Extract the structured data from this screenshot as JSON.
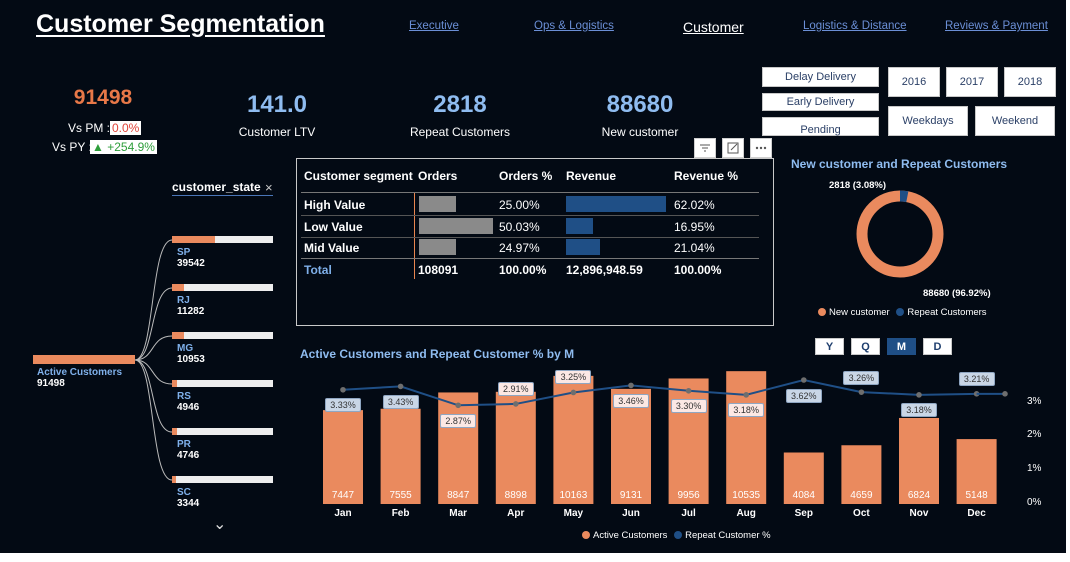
{
  "title": "Customer Segmentation",
  "nav": [
    "Executive",
    "Ops & Logistics",
    "Customer",
    "Logistics & Distance",
    "Reviews & Payment"
  ],
  "active_nav": "Customer",
  "kpis": {
    "active": {
      "value": "91498",
      "vs_pm_label": "Vs PM :",
      "vs_pm_value": "0.0%",
      "vs_py_label": "Vs PY :",
      "vs_py_value": "▲ +254.9%"
    },
    "ltv": {
      "value": "141.0",
      "label": "Customer LTV"
    },
    "repeat": {
      "value": "2818",
      "label": "Repeat Customers"
    },
    "new": {
      "value": "88680",
      "label": "New customer"
    }
  },
  "filters": {
    "delivery": [
      "Delay Delivery",
      "Early Delivery",
      "Pending"
    ],
    "years": [
      "2016",
      "2017",
      "2018"
    ],
    "days": [
      "Weekdays",
      "Weekend"
    ]
  },
  "visual_icons": [
    "filter-icon",
    "focus-mode-icon",
    "more-options-icon"
  ],
  "segment_table": {
    "headers": [
      "Customer segment",
      "Orders",
      "Orders %",
      "Revenue",
      "Revenue %"
    ],
    "rows": [
      {
        "segment": "High Value",
        "orders": 27023,
        "orders_pct": "25.00%",
        "revenue": 8002,
        "revenue_pct": "62.02%"
      },
      {
        "segment": "Low Value",
        "orders": 54075,
        "orders_pct": "50.03%",
        "revenue": 2186,
        "revenue_pct": "16.95%"
      },
      {
        "segment": "Mid Value",
        "orders": 26993,
        "orders_pct": "24.97%",
        "revenue": 2714,
        "revenue_pct": "21.04%"
      }
    ],
    "total": {
      "label": "Total",
      "orders": "108091",
      "orders_pct": "100.00%",
      "revenue": "12,896,948.59",
      "revenue_pct": "100.00%"
    }
  },
  "decomp_tree": {
    "header": "customer_state",
    "close": "×",
    "root": {
      "label": "Active Customers",
      "value": "91498"
    },
    "states": [
      {
        "code": "SP",
        "value": "39542",
        "share": 0.432
      },
      {
        "code": "RJ",
        "value": "11282",
        "share": 0.123
      },
      {
        "code": "MG",
        "value": "10953",
        "share": 0.12
      },
      {
        "code": "RS",
        "value": "4946",
        "share": 0.054
      },
      {
        "code": "PR",
        "value": "4746",
        "share": 0.052
      },
      {
        "code": "SC",
        "value": "3344",
        "share": 0.037
      }
    ],
    "expand": "⌄"
  },
  "donut": {
    "title": "New customer and Repeat Customers",
    "label_repeat": "2818 (3.08%)",
    "label_new": "88680 (96.92%)",
    "legend": [
      "New customer",
      "Repeat Customers"
    ]
  },
  "period_buttons": [
    "Y",
    "Q",
    "M",
    "D"
  ],
  "active_period": "M",
  "colors": {
    "orange": "#ea8a5e",
    "blue": "#1f4f86",
    "kpi_blue": "#8fbcf0",
    "bg": "#030a14"
  },
  "chart_data": {
    "type": "bar",
    "title": "Active Customers and Repeat Customer % by M",
    "categories": [
      "Jan",
      "Feb",
      "Mar",
      "Apr",
      "May",
      "Jun",
      "Jul",
      "Aug",
      "Sep",
      "Oct",
      "Nov",
      "Dec"
    ],
    "series": [
      {
        "name": "Active Customers",
        "type": "bar",
        "values": [
          7447,
          7555,
          8847,
          8898,
          10163,
          9131,
          9956,
          10535,
          4084,
          4659,
          6824,
          5148
        ]
      },
      {
        "name": "Repeat Customer %",
        "type": "line",
        "values": [
          3.33,
          3.43,
          2.87,
          2.91,
          3.25,
          3.46,
          3.3,
          3.18,
          3.62,
          3.26,
          3.18,
          3.21
        ],
        "labels": [
          "3.33%",
          "3.43%",
          "2.87%",
          "2.91%",
          "3.25%",
          "3.46%",
          "3.30%",
          "3.18%",
          "3.62%",
          "3.26%",
          "3.18%",
          "3.21%"
        ]
      }
    ],
    "y2_ticks": [
      "3%",
      "2%",
      "1%",
      "0%"
    ],
    "legend": [
      "Active Customers",
      "Repeat Customer %"
    ],
    "legend_position": "bottom"
  }
}
